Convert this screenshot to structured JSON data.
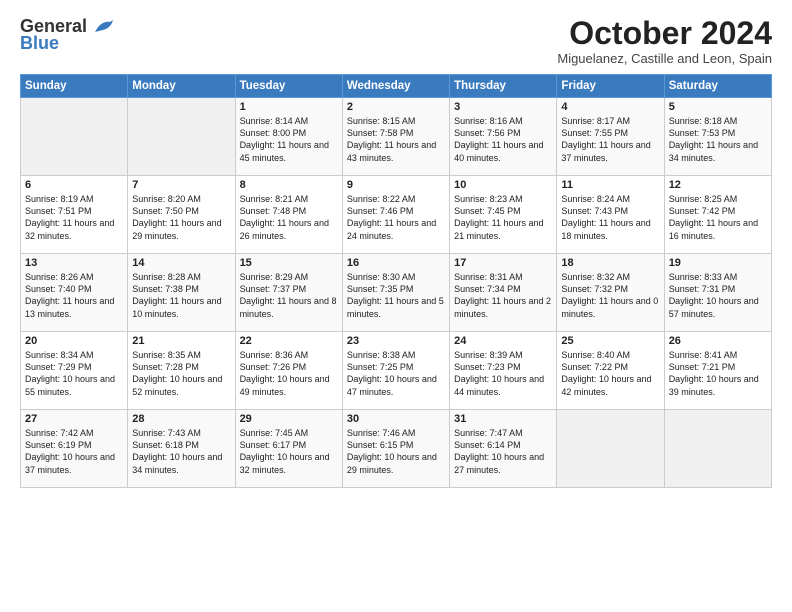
{
  "header": {
    "logo_general": "General",
    "logo_blue": "Blue",
    "month_title": "October 2024",
    "subtitle": "Miguelanez, Castille and Leon, Spain"
  },
  "weekdays": [
    "Sunday",
    "Monday",
    "Tuesday",
    "Wednesday",
    "Thursday",
    "Friday",
    "Saturday"
  ],
  "weeks": [
    [
      {
        "day": "",
        "empty": true
      },
      {
        "day": "",
        "empty": true
      },
      {
        "day": "1",
        "sunrise": "Sunrise: 8:14 AM",
        "sunset": "Sunset: 8:00 PM",
        "daylight": "Daylight: 11 hours and 45 minutes."
      },
      {
        "day": "2",
        "sunrise": "Sunrise: 8:15 AM",
        "sunset": "Sunset: 7:58 PM",
        "daylight": "Daylight: 11 hours and 43 minutes."
      },
      {
        "day": "3",
        "sunrise": "Sunrise: 8:16 AM",
        "sunset": "Sunset: 7:56 PM",
        "daylight": "Daylight: 11 hours and 40 minutes."
      },
      {
        "day": "4",
        "sunrise": "Sunrise: 8:17 AM",
        "sunset": "Sunset: 7:55 PM",
        "daylight": "Daylight: 11 hours and 37 minutes."
      },
      {
        "day": "5",
        "sunrise": "Sunrise: 8:18 AM",
        "sunset": "Sunset: 7:53 PM",
        "daylight": "Daylight: 11 hours and 34 minutes."
      }
    ],
    [
      {
        "day": "6",
        "sunrise": "Sunrise: 8:19 AM",
        "sunset": "Sunset: 7:51 PM",
        "daylight": "Daylight: 11 hours and 32 minutes."
      },
      {
        "day": "7",
        "sunrise": "Sunrise: 8:20 AM",
        "sunset": "Sunset: 7:50 PM",
        "daylight": "Daylight: 11 hours and 29 minutes."
      },
      {
        "day": "8",
        "sunrise": "Sunrise: 8:21 AM",
        "sunset": "Sunset: 7:48 PM",
        "daylight": "Daylight: 11 hours and 26 minutes."
      },
      {
        "day": "9",
        "sunrise": "Sunrise: 8:22 AM",
        "sunset": "Sunset: 7:46 PM",
        "daylight": "Daylight: 11 hours and 24 minutes."
      },
      {
        "day": "10",
        "sunrise": "Sunrise: 8:23 AM",
        "sunset": "Sunset: 7:45 PM",
        "daylight": "Daylight: 11 hours and 21 minutes."
      },
      {
        "day": "11",
        "sunrise": "Sunrise: 8:24 AM",
        "sunset": "Sunset: 7:43 PM",
        "daylight": "Daylight: 11 hours and 18 minutes."
      },
      {
        "day": "12",
        "sunrise": "Sunrise: 8:25 AM",
        "sunset": "Sunset: 7:42 PM",
        "daylight": "Daylight: 11 hours and 16 minutes."
      }
    ],
    [
      {
        "day": "13",
        "sunrise": "Sunrise: 8:26 AM",
        "sunset": "Sunset: 7:40 PM",
        "daylight": "Daylight: 11 hours and 13 minutes."
      },
      {
        "day": "14",
        "sunrise": "Sunrise: 8:28 AM",
        "sunset": "Sunset: 7:38 PM",
        "daylight": "Daylight: 11 hours and 10 minutes."
      },
      {
        "day": "15",
        "sunrise": "Sunrise: 8:29 AM",
        "sunset": "Sunset: 7:37 PM",
        "daylight": "Daylight: 11 hours and 8 minutes."
      },
      {
        "day": "16",
        "sunrise": "Sunrise: 8:30 AM",
        "sunset": "Sunset: 7:35 PM",
        "daylight": "Daylight: 11 hours and 5 minutes."
      },
      {
        "day": "17",
        "sunrise": "Sunrise: 8:31 AM",
        "sunset": "Sunset: 7:34 PM",
        "daylight": "Daylight: 11 hours and 2 minutes."
      },
      {
        "day": "18",
        "sunrise": "Sunrise: 8:32 AM",
        "sunset": "Sunset: 7:32 PM",
        "daylight": "Daylight: 11 hours and 0 minutes."
      },
      {
        "day": "19",
        "sunrise": "Sunrise: 8:33 AM",
        "sunset": "Sunset: 7:31 PM",
        "daylight": "Daylight: 10 hours and 57 minutes."
      }
    ],
    [
      {
        "day": "20",
        "sunrise": "Sunrise: 8:34 AM",
        "sunset": "Sunset: 7:29 PM",
        "daylight": "Daylight: 10 hours and 55 minutes."
      },
      {
        "day": "21",
        "sunrise": "Sunrise: 8:35 AM",
        "sunset": "Sunset: 7:28 PM",
        "daylight": "Daylight: 10 hours and 52 minutes."
      },
      {
        "day": "22",
        "sunrise": "Sunrise: 8:36 AM",
        "sunset": "Sunset: 7:26 PM",
        "daylight": "Daylight: 10 hours and 49 minutes."
      },
      {
        "day": "23",
        "sunrise": "Sunrise: 8:38 AM",
        "sunset": "Sunset: 7:25 PM",
        "daylight": "Daylight: 10 hours and 47 minutes."
      },
      {
        "day": "24",
        "sunrise": "Sunrise: 8:39 AM",
        "sunset": "Sunset: 7:23 PM",
        "daylight": "Daylight: 10 hours and 44 minutes."
      },
      {
        "day": "25",
        "sunrise": "Sunrise: 8:40 AM",
        "sunset": "Sunset: 7:22 PM",
        "daylight": "Daylight: 10 hours and 42 minutes."
      },
      {
        "day": "26",
        "sunrise": "Sunrise: 8:41 AM",
        "sunset": "Sunset: 7:21 PM",
        "daylight": "Daylight: 10 hours and 39 minutes."
      }
    ],
    [
      {
        "day": "27",
        "sunrise": "Sunrise: 7:42 AM",
        "sunset": "Sunset: 6:19 PM",
        "daylight": "Daylight: 10 hours and 37 minutes."
      },
      {
        "day": "28",
        "sunrise": "Sunrise: 7:43 AM",
        "sunset": "Sunset: 6:18 PM",
        "daylight": "Daylight: 10 hours and 34 minutes."
      },
      {
        "day": "29",
        "sunrise": "Sunrise: 7:45 AM",
        "sunset": "Sunset: 6:17 PM",
        "daylight": "Daylight: 10 hours and 32 minutes."
      },
      {
        "day": "30",
        "sunrise": "Sunrise: 7:46 AM",
        "sunset": "Sunset: 6:15 PM",
        "daylight": "Daylight: 10 hours and 29 minutes."
      },
      {
        "day": "31",
        "sunrise": "Sunrise: 7:47 AM",
        "sunset": "Sunset: 6:14 PM",
        "daylight": "Daylight: 10 hours and 27 minutes."
      },
      {
        "day": "",
        "empty": true
      },
      {
        "day": "",
        "empty": true
      }
    ]
  ]
}
